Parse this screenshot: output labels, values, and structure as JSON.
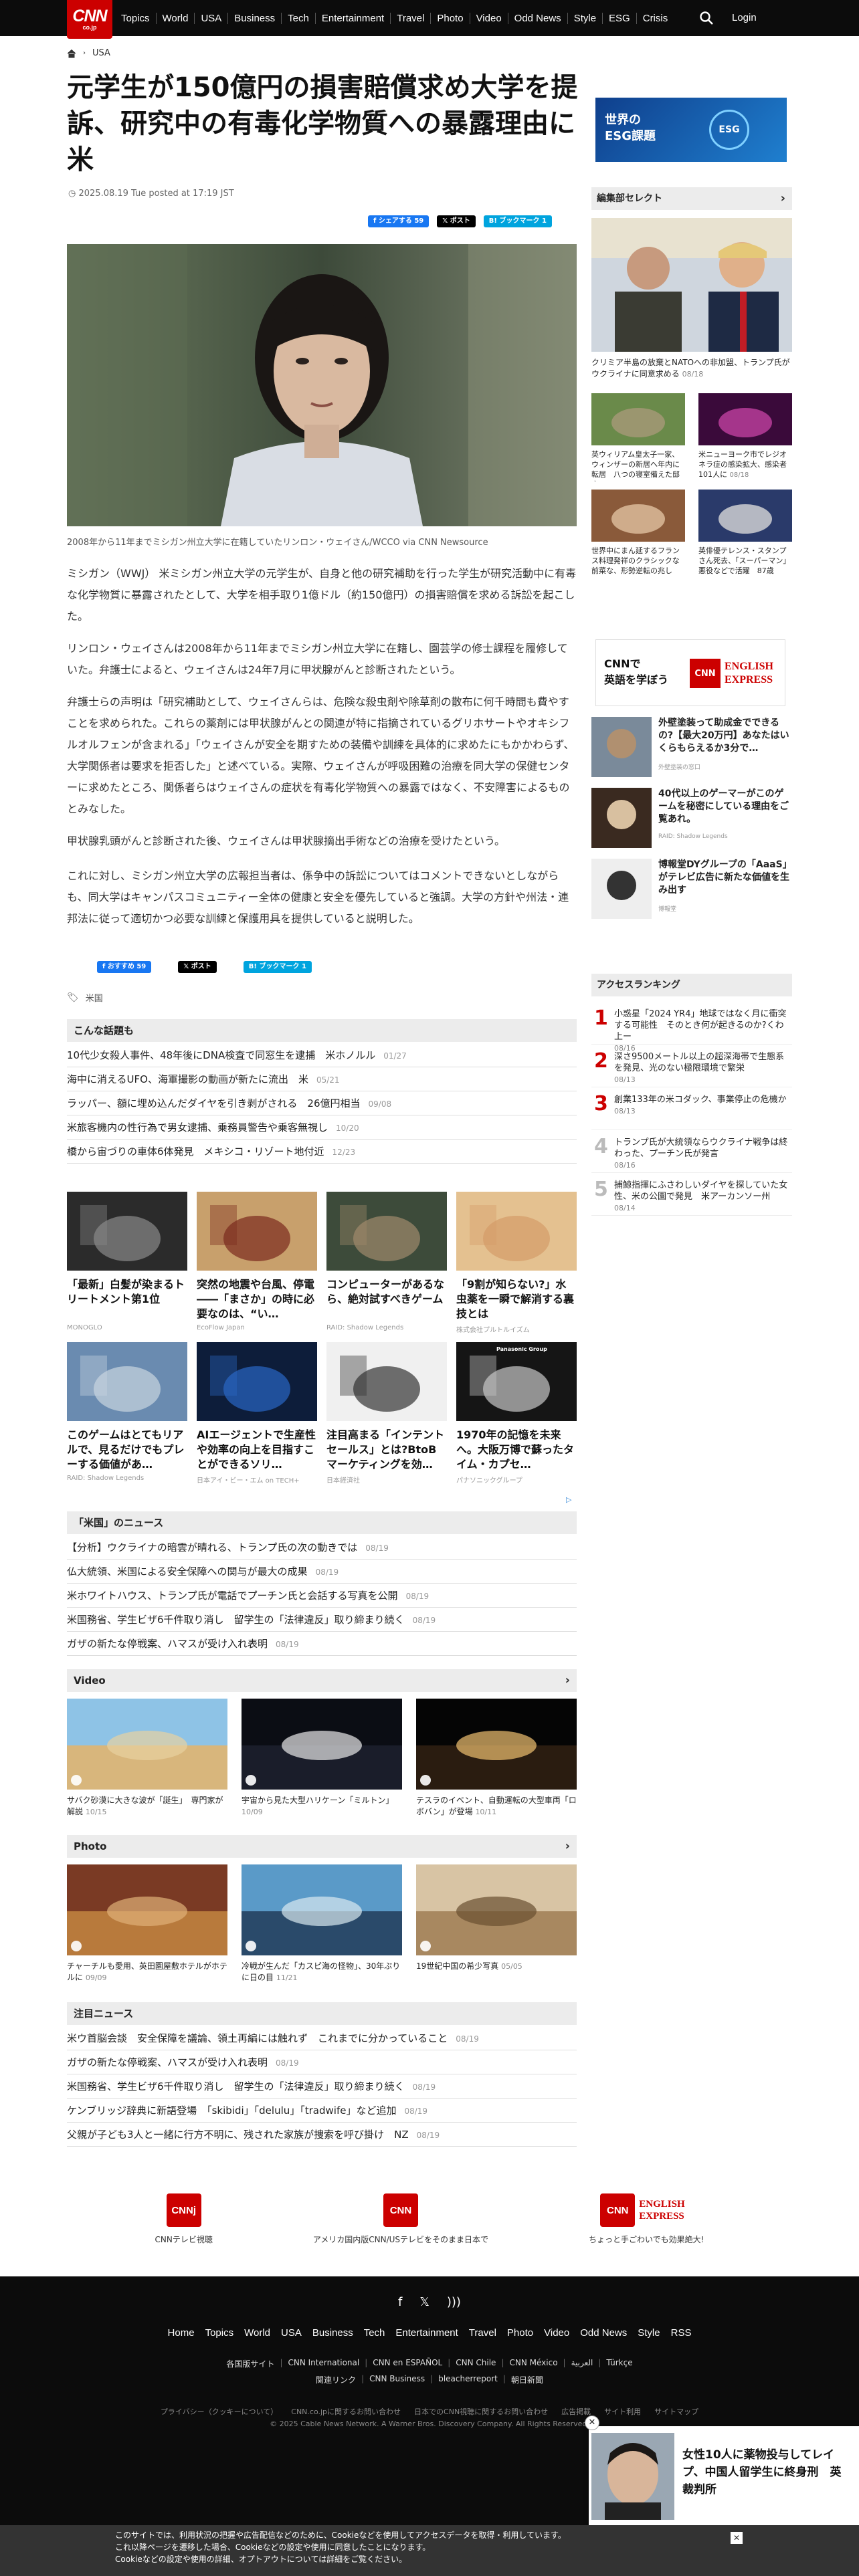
{
  "nav": {
    "logo": "CNN",
    "logo_sub": "co.jp",
    "items": [
      "Topics",
      "World",
      "USA",
      "Business",
      "Tech",
      "Entertainment",
      "Travel",
      "Photo",
      "Video",
      "Odd News",
      "Style",
      "ESG",
      "Crisis"
    ],
    "login": "Login"
  },
  "breadcrumb": {
    "section": "USA"
  },
  "article": {
    "title": "元学生が150億円の損害賠償求め大学を提訴、研究中の有毒化学物質への暴露理由に 米",
    "date": "2025.08.19 Tue posted at 17:19 JST",
    "share_fb": "シェアする 59",
    "share_x": "ポスト",
    "share_hb": "ブックマーク 1",
    "caption": "2008年から11年までミシガン州立大学に在籍していたリンロン・ウェイさん/WCCO via CNN Newsource",
    "paragraphs": [
      "ミシガン（WWJ） 米ミシガン州立大学の元学生が、自身と他の研究補助を行った学生が研究活動中に有毒な化学物質に暴露されたとして、大学を相手取り1億ドル（約150億円）の損害賠償を求める訴訟を起こした。",
      "リンロン・ウェイさんは2008年から11年までミシガン州立大学に在籍し、園芸学の修士課程を履修していた。弁護士によると、ウェイさんは24年7月に甲状腺がんと診断されたという。",
      "弁護士らの声明は「研究補助として、ウェイさんらは、危険な殺虫剤や除草剤の散布に何千時間も費やすことを求められた。これらの薬剤には甲状腺がんとの関連が特に指摘されているグリホサートやオキシフルオルフェンが含まれる」「ウェイさんが安全を期すための装備や訓練を具体的に求めたにもかかわらず、大学関係者は要求を拒否した」と述べている。実際、ウェイさんが呼吸困難の治療を同大学の保健センターに求めたところ、関係者らはウェイさんの症状を有毒化学物質への暴露ではなく、不安障害によるものとみなした。",
      "甲状腺乳頭がんと診断された後、ウェイさんは甲状腺摘出手術などの治療を受けたという。",
      "これに対し、ミシガン州立大学の広報担当者は、係争中の訴訟についてはコメントできないとしながらも、同大学はキャンパスコミュニティー全体の健康と安全を優先していると強調。大学の方針や州法・連邦法に従って適切かつ必要な訓練と保護用具を提供していると説明した。"
    ],
    "share_fb_bottom": "おすすめ 59",
    "tag": "米国"
  },
  "related": {
    "heading": "こんな話題も",
    "items": [
      {
        "text": "10代少女殺人事件、48年後にDNA検査で同窓生を逮捕　米ホノルル",
        "date": "01/27"
      },
      {
        "text": "海中に消えるUFO、海軍撮影の動画が新たに流出　米",
        "date": "05/21"
      },
      {
        "text": "ラッパー、額に埋め込んだダイヤを引き剥がされる　26億円相当",
        "date": "09/08"
      },
      {
        "text": "米旅客機内の性行為で男女逮捕、乗務員警告や乗客無視し",
        "date": "10/20"
      },
      {
        "text": "橋から宙づりの車体6体発見　メキシコ・リゾート地付近",
        "date": "12/23"
      }
    ]
  },
  "ads": [
    {
      "title": "「最新」白髪が染まるトリートメント第1位",
      "sponsor": "MONOGLO"
    },
    {
      "title": "突然の地震や台風、停電――「まさか」の時に必要なのは、“い…",
      "sponsor": "EcoFlow Japan"
    },
    {
      "title": "コンピューターがあるなら、絶対試すべきゲーム",
      "sponsor": "RAID: Shadow Legends"
    },
    {
      "title": "「9割が知らない?」水虫薬を一瞬で解消する裏技とは",
      "sponsor": "株式会社プルトルイズム"
    },
    {
      "title": "このゲームはとてもリアルで、見るだけでもプレーする価値があ…",
      "sponsor": "RAID: Shadow Legends"
    },
    {
      "title": "AIエージェントで生産性や効率の向上を目指すことができるソリ…",
      "sponsor": "日本アイ・ビー・エム on TECH+"
    },
    {
      "title": "注目高まる「インテントセールス」とは?BtoBマーケティングを効…",
      "sponsor": "日本経済社"
    },
    {
      "title": "1970年の記憶を未来へ。大阪万博で蘇ったタイム・カプセ…",
      "sponsor": "パナソニックグループ"
    }
  ],
  "ads_brand": "Panasonic Group",
  "usnews": {
    "heading": "「米国」のニュース",
    "items": [
      {
        "text": "【分析】ウクライナの暗雲が晴れる、トランプ氏の次の動きでは",
        "date": "08/19"
      },
      {
        "text": "仏大統領、米国による安全保障への関与が最大の成果",
        "date": "08/19"
      },
      {
        "text": "米ホワイトハウス、トランプ氏が電話でプーチン氏と会話する写真を公開",
        "date": "08/19"
      },
      {
        "text": "米国務省、学生ビザ6千件取り消し　留学生の「法律違反」取り締まり続く",
        "date": "08/19"
      },
      {
        "text": "ガザの新たな停戦案、ハマスが受け入れ表明",
        "date": "08/19"
      }
    ]
  },
  "video": {
    "heading": "Video",
    "items": [
      {
        "text": "サバク砂漠に大きな波が「誕生」　専門家が解説",
        "date": "10/15"
      },
      {
        "text": "宇宙から見た大型ハリケーン「ミルトン」",
        "date": "10/09"
      },
      {
        "text": "テスラのイベント、自動運転の大型車両「ロボバン」が登場",
        "date": "10/11"
      }
    ]
  },
  "photo": {
    "heading": "Photo",
    "items": [
      {
        "text": "チャーチルも愛用、英田園屋敷ホテルがホテルに",
        "date": "09/09"
      },
      {
        "text": "冷戦が生んだ「カスピ海の怪物」、30年ぶりに日の目",
        "date": "11/21"
      },
      {
        "text": "19世紀中国の希少写真",
        "date": "05/05"
      }
    ]
  },
  "featured": {
    "heading": "注目ニュース",
    "items": [
      {
        "text": "米ウ首脳会談　安全保障を議論、領土再編には触れず　これまでに分かっていること",
        "date": "08/19"
      },
      {
        "text": "ガザの新たな停戦案、ハマスが受け入れ表明",
        "date": "08/19"
      },
      {
        "text": "米国務省、学生ビザ6千件取り消し　留学生の「法律違反」取り締まり続く",
        "date": "08/19"
      },
      {
        "text": "ケンブリッジ辞典に新語登場　「skibidi」「delulu」「tradwife」など追加",
        "date": "08/19"
      },
      {
        "text": "父親が子ども3人と一緒に行方不明に、残された家族が捜索を呼び掛け　NZ",
        "date": "08/19"
      }
    ]
  },
  "sidebar": {
    "esg": {
      "label1": "世界の",
      "label2": "ESG課題",
      "badge": "ESG"
    },
    "pick_heading": "編集部セレクト",
    "picks": [
      {
        "text": "クリミア半島の放棄とNATOへの非加盟、トランプ氏がウクライナに同意求める",
        "date": "08/18"
      },
      {
        "text": "英ウィリアム皇太子一家、ウィンザーの新居へ年内に転居　八つの寝室備えた邸宅",
        "date": "08/16"
      },
      {
        "text": "米ニューヨーク市でレジオネラ症の感染拡大、感染者101人に",
        "date": "08/18"
      },
      {
        "text": "世界中にまん延するフランス料理発祥のクラシックな前菜な、形勢逆転の兆し",
        "date": "08/18"
      },
      {
        "text": "英俳優テレンス・スタンプさん死去、「スーパーマン」悪役などで活躍　87歳",
        "date": "08/18"
      }
    ],
    "cnnee": {
      "line1": "CNNで",
      "line2": "英語を学ぼう",
      "brand1": "CNN",
      "brand2": "ENGLISH EXPRESS"
    },
    "sidead": [
      {
        "text": "外壁塗装って助成金でできるの?【最大20万円】あなたはいくらもらえるか3分で…",
        "sponsor": "外壁塗装の窓口"
      },
      {
        "text": "40代以上のゲーマーがこのゲームを秘密にしている理由をご覧あれ。",
        "sponsor": "RAID: Shadow Legends"
      },
      {
        "text": "博報堂DYグループの「AaaS」がテレビ広告に新たな価値を生み出す",
        "sponsor": "博報堂"
      }
    ],
    "rank_heading": "アクセスランキング",
    "ranking": [
      {
        "n": "1",
        "text": "小惑星「2024 YR4」地球ではなく月に衝突する可能性　そのとき何が起きるのか?くわ上ー",
        "date": "08/16"
      },
      {
        "n": "2",
        "text": "深さ9500メートル以上の超深海帯で生態系を発見、光のない極限環境で繁栄",
        "date": "08/13"
      },
      {
        "n": "3",
        "text": "創業133年の米コダック、事業停止の危機か",
        "date": "08/13"
      },
      {
        "n": "4",
        "text": "トランプ氏が大統領ならウクライナ戦争は終わった、プーチン氏が発言",
        "date": "08/16"
      },
      {
        "n": "5",
        "text": "捕鯨指揮にふさわしいダイヤを探していた女性、米の公園で発見　米アーカンソー州",
        "date": "08/14"
      }
    ]
  },
  "footlogos": [
    {
      "badge": "CNNj",
      "label": "CNNテレビ視聴"
    },
    {
      "badge": "CNN",
      "label": "アメリカ国内版CNN/USテレビをそのまま日本で"
    },
    {
      "badge": "CNN",
      "brand": "ENGLISH EXPRESS",
      "label": "ちょっと手ごわいでも効果絶大!"
    }
  ],
  "footer": {
    "links": [
      "Home",
      "Topics",
      "World",
      "USA",
      "Business",
      "Tech",
      "Entertainment",
      "Travel",
      "Photo",
      "Video",
      "Odd News",
      "Style",
      "RSS"
    ],
    "sites_label": "各国版サイト",
    "sites": [
      "CNN International",
      "CNN en ESPAÑOL",
      "CNN Chile",
      "CNN México",
      "العربية",
      "Türkçe"
    ],
    "related_label": "関連リンク",
    "related": [
      "CNN Business",
      "bleacherreport",
      "朝日新聞"
    ],
    "legal": [
      "プライバシー（クッキーについて）",
      "CNN.co.jpに関するお問い合わせ",
      "日本でのCNN視聴に関するお問い合わせ",
      "広告掲載",
      "サイト利用",
      "サイトマップ"
    ],
    "copyright": "© 2025 Cable News Network. A Warner Bros. Discovery Company. All Rights Reserved."
  },
  "popup": {
    "text": "女性10人に薬物投与してレイプ、中国人留学生に終身刑　英裁判所"
  },
  "cookie": {
    "line1": "このサイトでは、利用状況の把握や広告配信などのために、Cookieなどを使用してアクセスデータを取得・利用しています。",
    "line2": "これ以降ページを遷移した場合、Cookieなどの設定や使用に同意したことになります。",
    "line3": "Cookieなどの設定や使用の詳細、オプトアウトについては詳細をご覧ください。"
  },
  "colors": {
    "brand": "#cc0000",
    "topbar": "#0c0c0c",
    "link": "#1877f2"
  }
}
